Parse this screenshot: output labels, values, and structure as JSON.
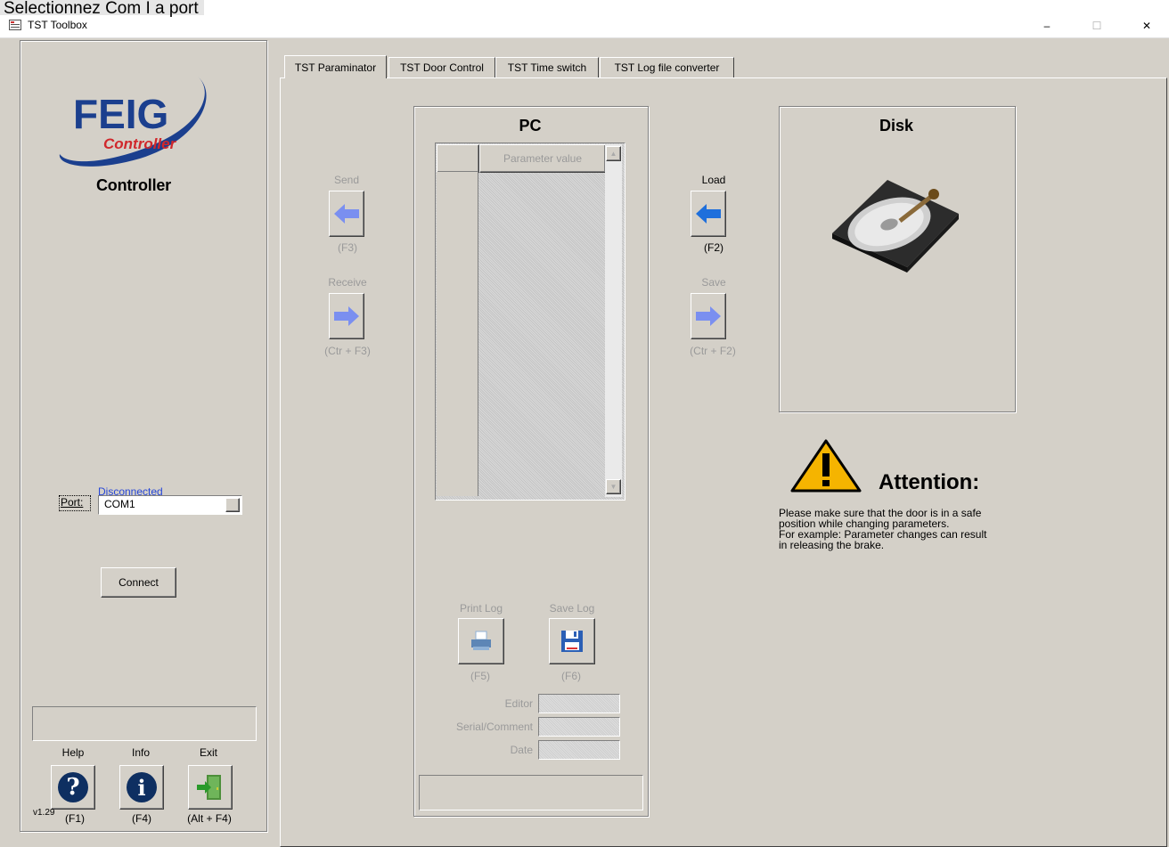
{
  "overlay_caption": "Selectionnez Com I a  port",
  "window": {
    "title": "TST Toolbox",
    "controls": {
      "minimize": "–",
      "maximize": "☐",
      "close": "✕"
    }
  },
  "left": {
    "logo_main": "FEIG",
    "logo_sub": "Controller",
    "title": "Controller",
    "disconnected_text": "Disconnected",
    "port_label": "Port:",
    "port_value": "COM1",
    "connect_label": "Connect",
    "tools": [
      {
        "label": "Help",
        "key": "(F1)",
        "glyph": "?"
      },
      {
        "label": "Info",
        "key": "(F4)",
        "glyph": "i"
      },
      {
        "label": "Exit",
        "key": "(Alt + F4)"
      }
    ],
    "version": "v1.29"
  },
  "tabs": [
    "TST Paraminator",
    "TST Door Control",
    "TST Time switch",
    "TST Log file converter"
  ],
  "pc": {
    "title": "PC",
    "grid_header": "Parameter value",
    "send_label": "Send",
    "send_key": "(F3)",
    "receive_label": "Receive",
    "receive_key": "(Ctr + F3)",
    "print_label": "Print Log",
    "print_key": "(F5)",
    "savelog_label": "Save Log",
    "savelog_key": "(F6)",
    "editor_label": "Editor",
    "serial_label": "Serial/Comment",
    "date_label": "Date"
  },
  "disk": {
    "title": "Disk",
    "load_label": "Load",
    "load_key": "(F2)",
    "save_label": "Save",
    "save_key": "(Ctr + F2)"
  },
  "warning": {
    "title": "Attention:",
    "line1": "Please make sure that the door is in a safe",
    "line2": "position while changing parameters.",
    "line3": "For example: Parameter changes can result",
    "line4": "in releasing the brake."
  },
  "colors": {
    "dialog_bg": "#d4d0c8",
    "arrow_blue": "#1e6fdc",
    "arrow_dim": "#7a8ff0",
    "logo_blue": "#1b3f8e",
    "logo_red": "#d0282c",
    "warn_yellow": "#f5b400"
  }
}
